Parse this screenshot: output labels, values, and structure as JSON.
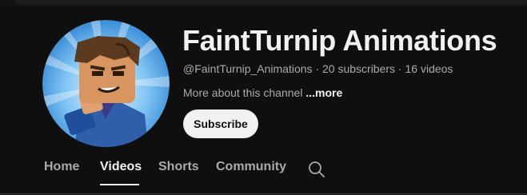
{
  "channel": {
    "name": "FaintTurnip Animations",
    "handle": "@FaintTurnip_Animations",
    "separator": " · ",
    "subscribers": "20 subscribers",
    "videos": "16 videos",
    "about_text": "More about this channel ",
    "more_link": "...more",
    "subscribe_label": "Subscribe",
    "avatar_icon": "channel-avatar"
  },
  "tabs": [
    {
      "label": "Home",
      "active": false
    },
    {
      "label": "Videos",
      "active": true
    },
    {
      "label": "Shorts",
      "active": false
    },
    {
      "label": "Community",
      "active": false
    }
  ],
  "search_icon": "search-icon",
  "colors": {
    "background": "#0f0f0f",
    "text_primary": "#f1f1f1",
    "text_secondary": "#aaaaaa",
    "subscribe_bg": "#f1f1f1",
    "subscribe_text": "#0f0f0f"
  }
}
